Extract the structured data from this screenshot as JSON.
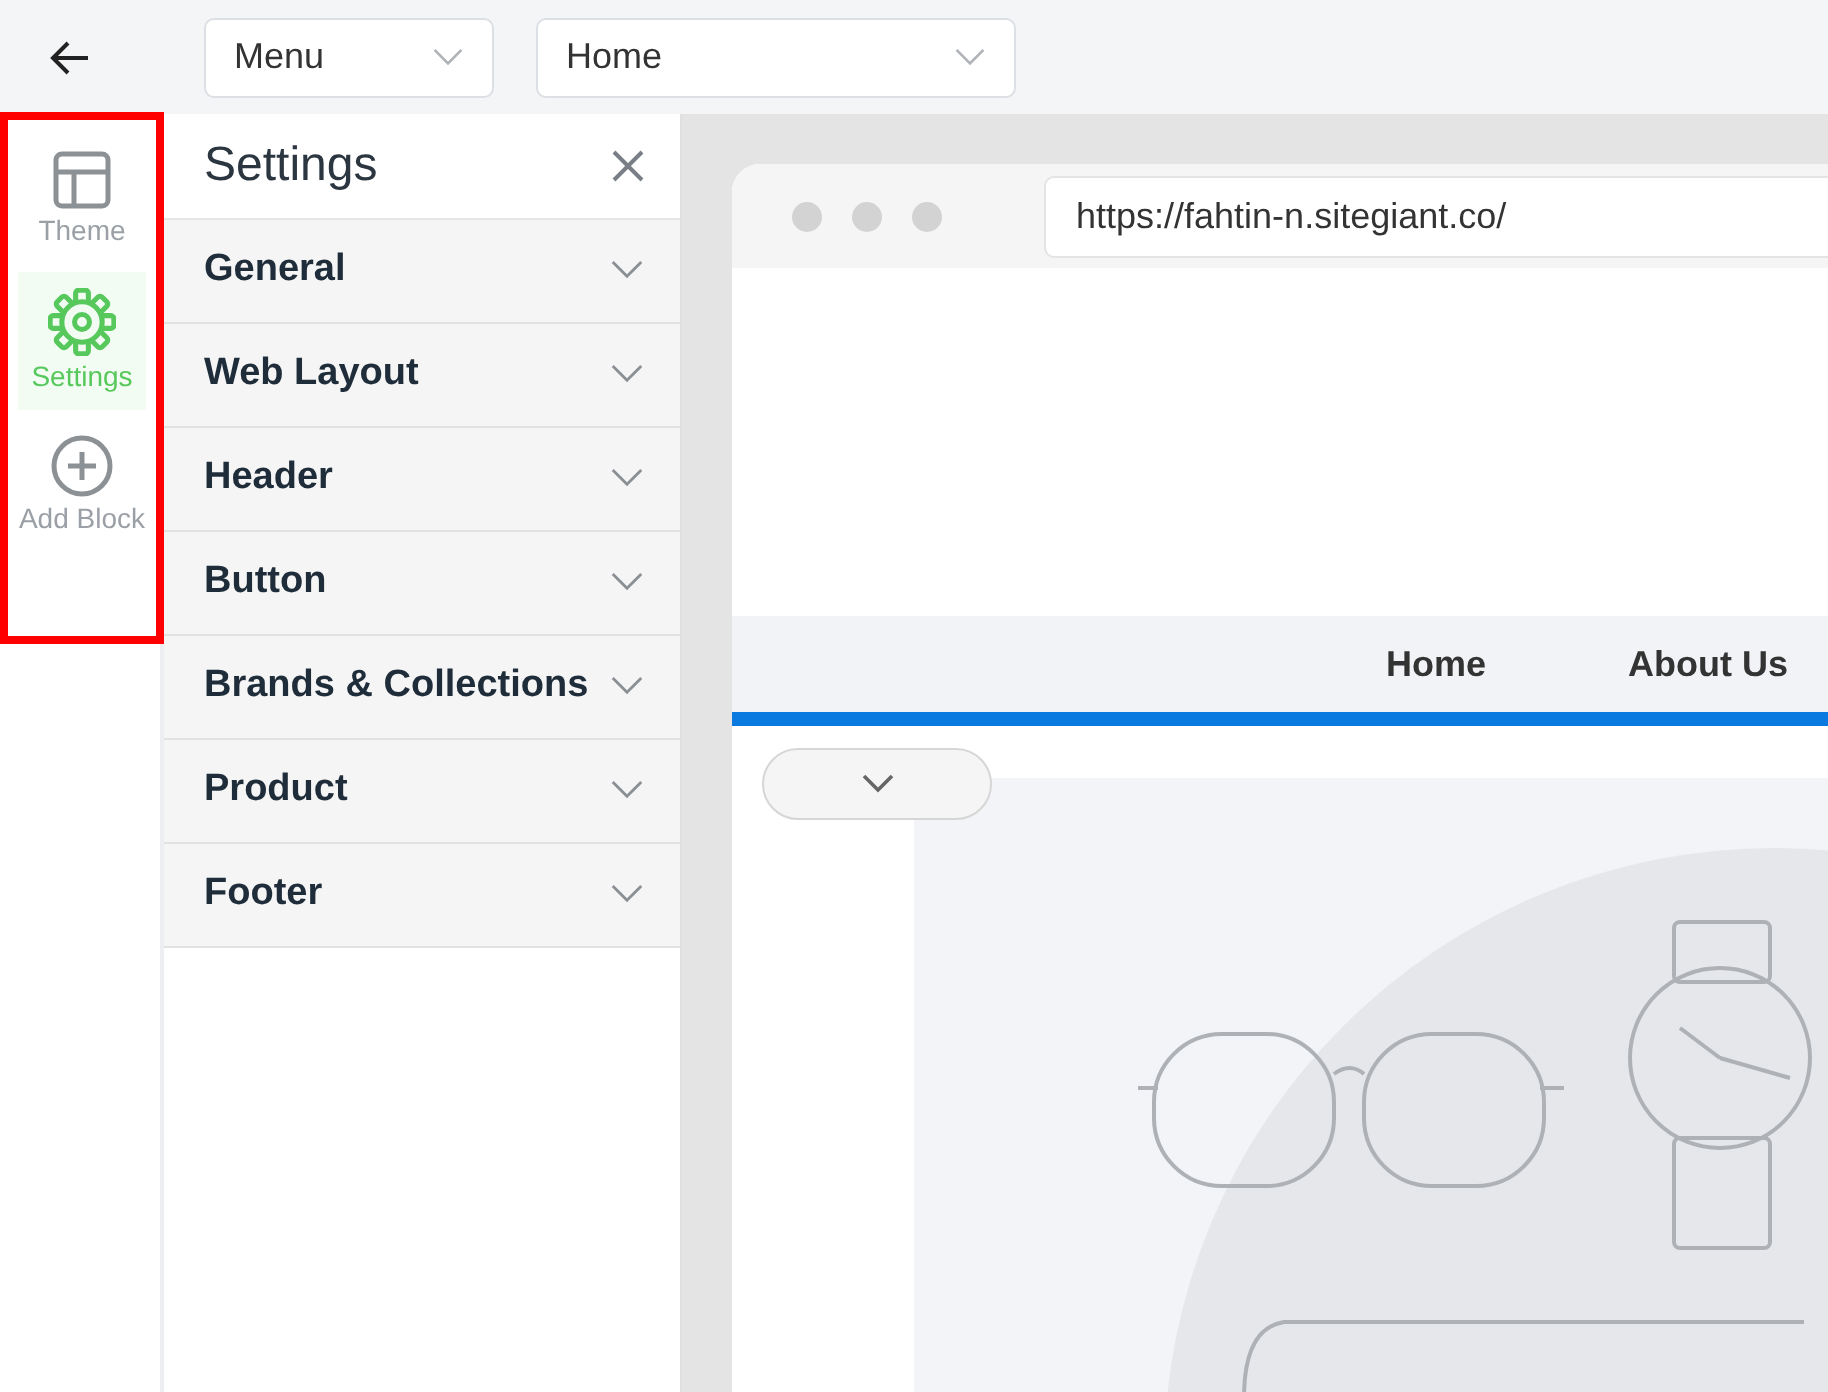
{
  "toolbar": {
    "menu_select": "Menu",
    "page_select": "Home"
  },
  "rail": {
    "highlighted": true,
    "items": [
      {
        "label": "Theme",
        "kind": "layout",
        "selected": false
      },
      {
        "label": "Settings",
        "kind": "gear",
        "selected": true
      },
      {
        "label": "Add Block",
        "kind": "plus",
        "selected": false
      }
    ]
  },
  "settings_panel": {
    "title": "Settings",
    "sections": [
      {
        "label": "General",
        "expanded": false
      },
      {
        "label": "Web Layout",
        "expanded": false
      },
      {
        "label": "Header",
        "expanded": false
      },
      {
        "label": "Button",
        "expanded": false
      },
      {
        "label": "Brands & Collections",
        "expanded": false
      },
      {
        "label": "Product",
        "expanded": false
      },
      {
        "label": "Footer",
        "expanded": false
      }
    ]
  },
  "preview": {
    "url": "https://fahtin-n.sitegiant.co/",
    "nav_links": [
      "Home",
      "About Us"
    ]
  }
}
